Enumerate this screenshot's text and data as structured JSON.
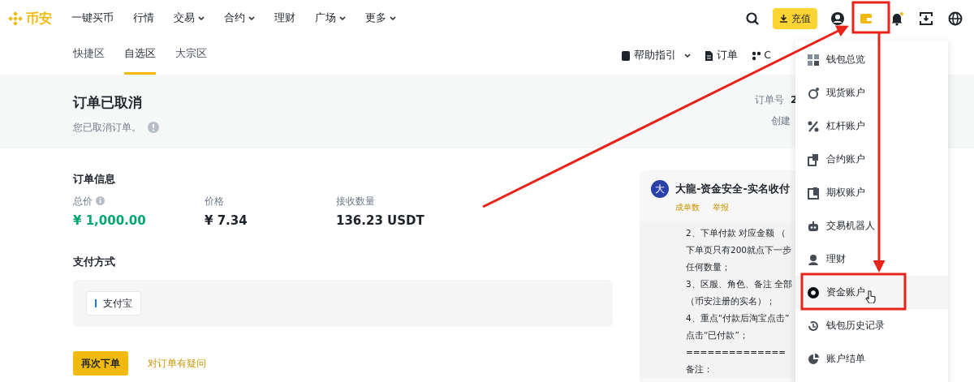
{
  "logo": {
    "text": "币安"
  },
  "nav": [
    {
      "label": "一键买币",
      "dropdown": false
    },
    {
      "label": "行情",
      "dropdown": false
    },
    {
      "label": "交易",
      "dropdown": true
    },
    {
      "label": "合约",
      "dropdown": true
    },
    {
      "label": "理财",
      "dropdown": false
    },
    {
      "label": "广场",
      "dropdown": true
    },
    {
      "label": "更多",
      "dropdown": true
    }
  ],
  "deposit_button": "充值",
  "subtabs": [
    {
      "label": "快捷区",
      "selected": false
    },
    {
      "label": "自选区",
      "selected": true
    },
    {
      "label": "大宗区",
      "selected": false
    }
  ],
  "sub_actions": [
    {
      "label": "帮助指引",
      "dropdown": true
    },
    {
      "label": "订单",
      "dropdown": false
    },
    {
      "label": "C",
      "dropdown": false
    }
  ],
  "status": {
    "title": "订单已取消",
    "message": "您已取消订单。",
    "order_no_label": "订单号",
    "order_no": "2",
    "created_label": "创建"
  },
  "order_info": {
    "title": "订单信息",
    "fields": [
      {
        "label": "总价",
        "info": true,
        "value": "¥ 1,000.00",
        "highlight": true
      },
      {
        "label": "价格",
        "info": false,
        "value": "¥ 7.34",
        "highlight": false
      },
      {
        "label": "接收数量",
        "info": false,
        "value": "136.23 USDT",
        "highlight": false
      }
    ]
  },
  "payment": {
    "title": "支付方式",
    "method": "支付宝"
  },
  "actions": {
    "primary": "再次下单",
    "link": "对订单有疑问"
  },
  "seller": {
    "avatar": "大",
    "name": "大龍-资金安全-实名收付",
    "links": [
      "成单数",
      "举报"
    ],
    "lines": [
      "2、下单付款 对应金额 （",
      "下单页只有200就点下一步",
      "任何数量；",
      "3、区服、角色、备注 全部",
      "（币安注册的实名）；",
      "4、重点“付款后淘宝点击”",
      "点击“已付款”；",
      "==============",
      "备注："
    ]
  },
  "wallet_menu": [
    {
      "label": "钱包总览",
      "selected": false
    },
    {
      "label": "现货账户",
      "selected": false
    },
    {
      "label": "杠杆账户",
      "selected": false
    },
    {
      "label": "合约账户",
      "selected": false
    },
    {
      "label": "期权账户",
      "selected": false
    },
    {
      "label": "交易机器人",
      "selected": false
    },
    {
      "label": "理财",
      "selected": false
    },
    {
      "label": "资金账户",
      "selected": true
    },
    {
      "label": "钱包历史记录",
      "selected": false
    },
    {
      "label": "账户结单",
      "selected": false
    }
  ]
}
